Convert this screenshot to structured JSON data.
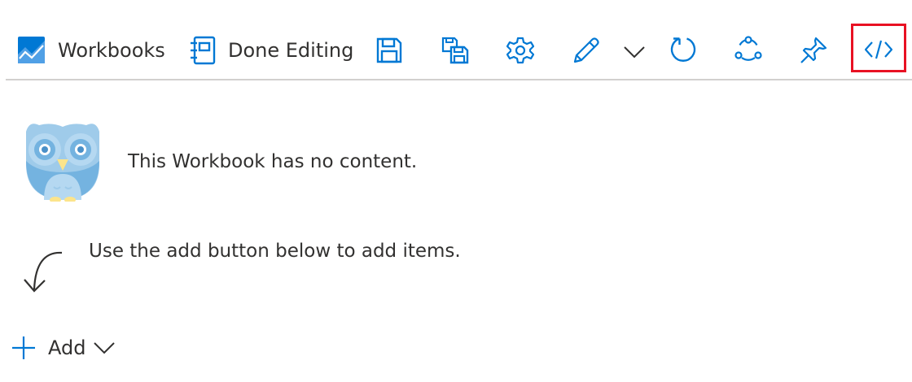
{
  "toolbar": {
    "workbooks_label": "Workbooks",
    "done_editing_label": "Done Editing",
    "icons": {
      "workbooks": "workbooks-chart-icon",
      "done_editing": "notebook-icon",
      "save": "save-icon",
      "save_as": "save-as-icon",
      "settings": "gear-icon",
      "edit": "pencil-icon",
      "dropdown": "chevron-down-icon",
      "refresh": "refresh-icon",
      "share": "share-icon",
      "pin": "pin-icon",
      "advanced_editor": "code-icon"
    },
    "highlighted_item": "advanced_editor"
  },
  "main": {
    "empty_message": "This Workbook has no content.",
    "hint_message": "Use the add button below to add items.",
    "add_label": "Add"
  },
  "colors": {
    "accent": "#0078d4",
    "highlight": "#e81123",
    "text": "#323130",
    "divider": "#d2d0ce",
    "owl_body": "#9fcbea",
    "owl_dark": "#74b3e0",
    "owl_beak": "#fce48b"
  }
}
